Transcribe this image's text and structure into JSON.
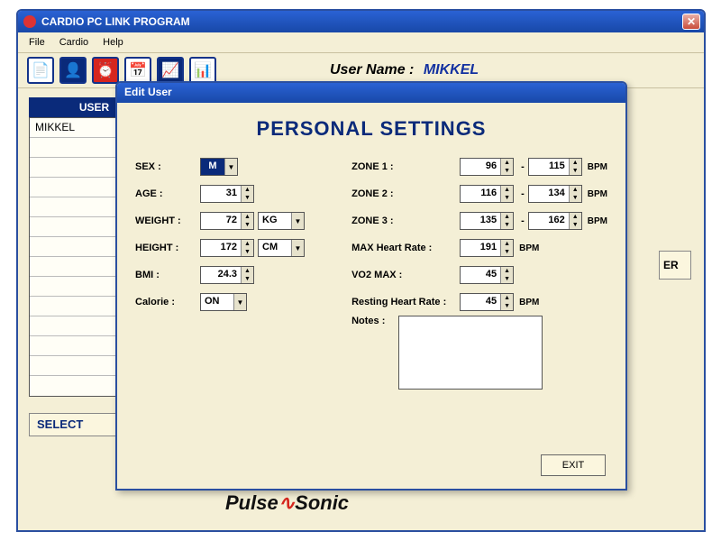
{
  "window": {
    "title": "CARDIO PC LINK PROGRAM"
  },
  "menu": {
    "file": "File",
    "cardio": "Cardio",
    "help": "Help"
  },
  "toolbarUser": {
    "label": "User Name :",
    "value": "MIKKEL"
  },
  "userPanel": {
    "header": "USER",
    "items": [
      "MIKKEL"
    ],
    "selectLabel": "SELECT"
  },
  "sideFragment": "ER",
  "dialog": {
    "title": "Edit User",
    "heading": "PERSONAL SETTINGS",
    "labels": {
      "sex": "SEX :",
      "age": "AGE :",
      "weight": "WEIGHT :",
      "height": "HEIGHT :",
      "bmi": "BMI :",
      "calorie": "Calorie :",
      "zone1": "ZONE 1 :",
      "zone2": "ZONE 2 :",
      "zone3": "ZONE 3 :",
      "maxhr": "MAX Heart Rate :",
      "vo2": "VO2 MAX :",
      "resthr": "Resting Heart Rate :",
      "notes": "Notes :"
    },
    "values": {
      "sex": "M",
      "age": "31",
      "weight": "72",
      "weightUnit": "KG",
      "height": "172",
      "heightUnit": "CM",
      "bmi": "24.3",
      "calorie": "ON",
      "zone1lo": "96",
      "zone1hi": "115",
      "zone2lo": "116",
      "zone2hi": "134",
      "zone3lo": "135",
      "zone3hi": "162",
      "maxhr": "191",
      "vo2": "45",
      "resthr": "45"
    },
    "unitBpm": "BPM",
    "exit": "EXIT"
  }
}
